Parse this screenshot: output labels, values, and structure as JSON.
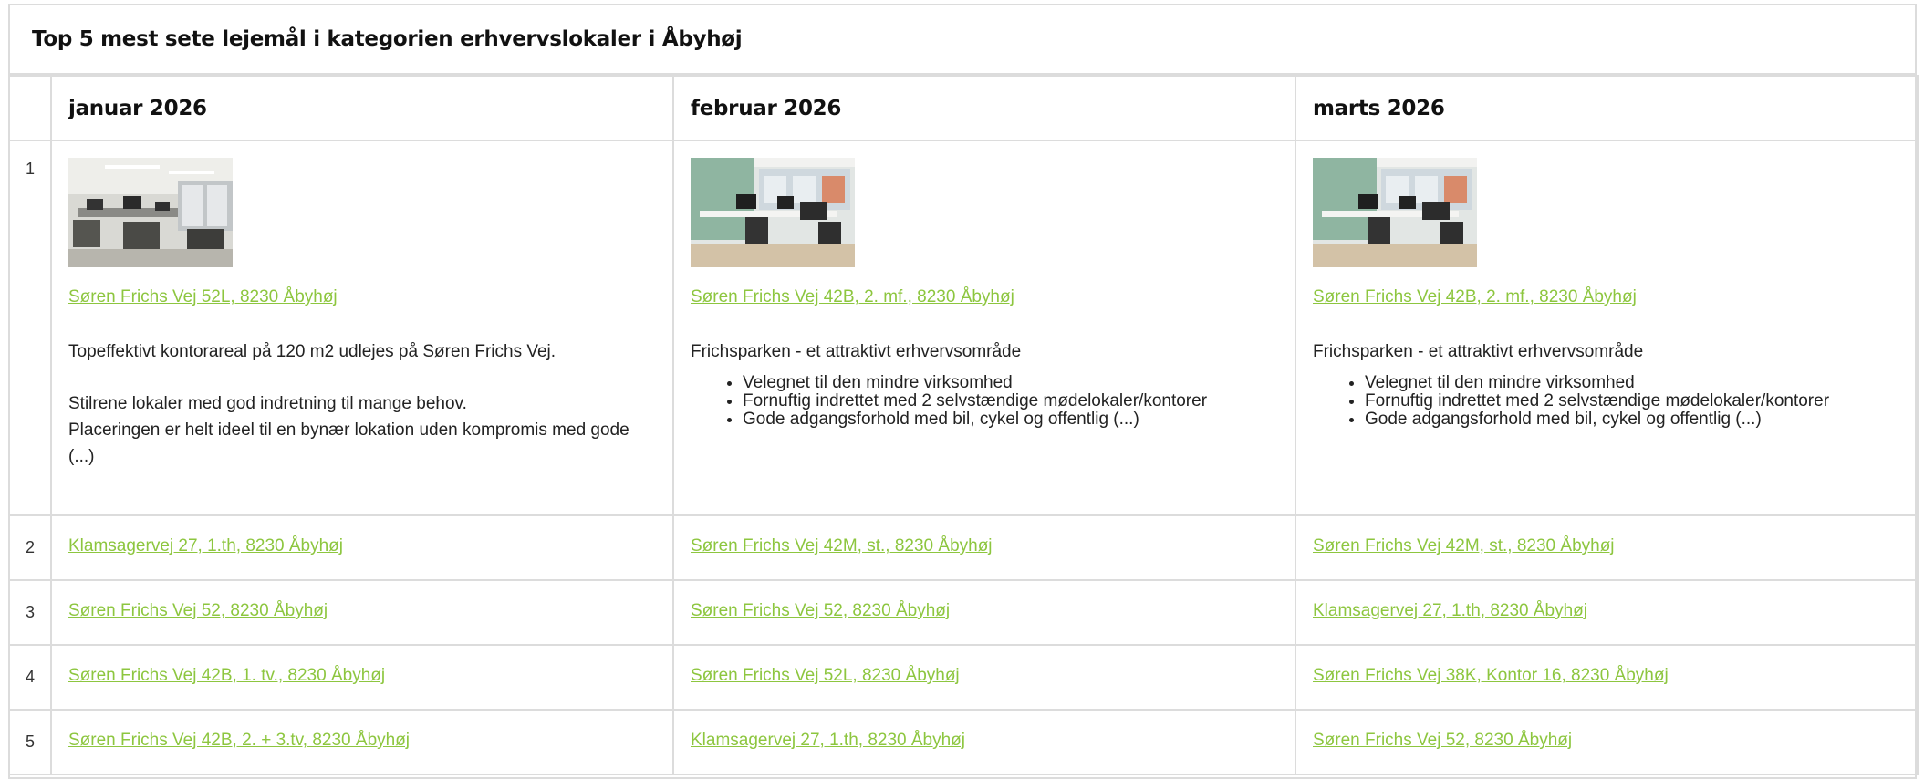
{
  "title": "Top 5 mest sete lejemål i kategorien erhvervslokaler i Åbyhøj",
  "months": [
    "januar 2026",
    "februar 2026",
    "marts 2026"
  ],
  "top": [
    {
      "address": "Søren Frichs Vej 52L, 8230 Åbyhøj",
      "paragraphs": [
        "Topeffektivt kontorareal på 120 m2 udlejes på Søren Frichs Vej.",
        "Stilrene lokaler med god indretning til mange behov.",
        "Placeringen er helt ideel til en bynær lokation uden kompromis med gode (...)"
      ],
      "bullets": [],
      "image_icon": "office-photo-icon"
    },
    {
      "address": "Søren Frichs Vej 42B, 2. mf., 8230 Åbyhøj",
      "paragraphs": [
        "Frichsparken - et attraktivt erhvervsområde"
      ],
      "bullets": [
        "Velegnet til den mindre virksomhed",
        "Fornuftig indrettet med 2 selvstændige mødelokaler/kontorer",
        "Gode adgangsforhold med bil, cykel og offentlig (...)"
      ],
      "image_icon": "office-photo-icon"
    },
    {
      "address": "Søren Frichs Vej 42B, 2. mf., 8230 Åbyhøj",
      "paragraphs": [
        "Frichsparken - et attraktivt erhvervsområde"
      ],
      "bullets": [
        "Velegnet til den mindre virksomhed",
        "Fornuftig indrettet med 2 selvstændige mødelokaler/kontorer",
        "Gode adgangsforhold med bil, cykel og offentlig (...)"
      ],
      "image_icon": "office-photo-icon"
    }
  ],
  "rows": [
    {
      "rank": "2",
      "addresses": [
        "Klamsagervej 27, 1.th, 8230 Åbyhøj",
        "Søren Frichs Vej 42M, st., 8230 Åbyhøj",
        "Søren Frichs Vej 42M, st., 8230 Åbyhøj"
      ]
    },
    {
      "rank": "3",
      "addresses": [
        "Søren Frichs Vej 52, 8230 Åbyhøj",
        "Søren Frichs Vej 52, 8230 Åbyhøj",
        "Klamsagervej 27, 1.th, 8230 Åbyhøj"
      ]
    },
    {
      "rank": "4",
      "addresses": [
        "Søren Frichs Vej 42B, 1. tv., 8230 Åbyhøj",
        "Søren Frichs Vej 52L, 8230 Åbyhøj",
        "Søren Frichs Vej 38K, Kontor 16, 8230 Åbyhøj"
      ]
    },
    {
      "rank": "5",
      "addresses": [
        "Søren Frichs Vej 42B, 2. + 3.tv, 8230 Åbyhøj",
        "Klamsagervej 27, 1.th, 8230 Åbyhøj",
        "Søren Frichs Vej 52, 8230 Åbyhøj"
      ]
    }
  ],
  "colors": {
    "link": "#8dc63f",
    "border": "#dcdcdc"
  }
}
